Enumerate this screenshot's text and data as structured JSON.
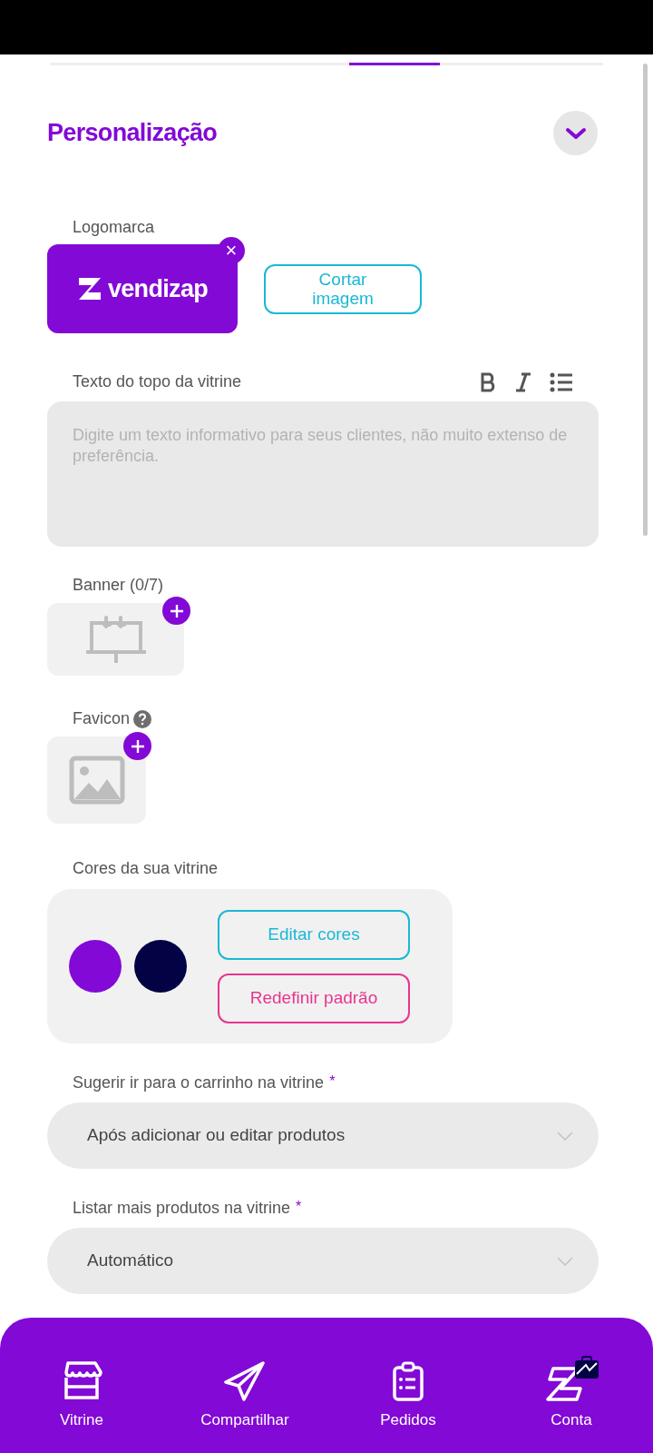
{
  "section": {
    "title": "Personalização",
    "expanded": true
  },
  "logo": {
    "label": "Logomarca",
    "wordmark": "vendizap",
    "crop_button": "Cortar imagem",
    "remove_icon": "×"
  },
  "header_text": {
    "label": "Texto do topo da vitrine",
    "placeholder": "Digite um texto informativo para seus clientes, não muito extenso de preferência."
  },
  "banner": {
    "label": "Banner (0/7)"
  },
  "favicon": {
    "label": "Favicon"
  },
  "colors": {
    "label": "Cores da sua vitrine",
    "swatches": [
      {
        "color": "#8309d6"
      },
      {
        "color": "#020244"
      }
    ],
    "buttons": [
      {
        "kind": "edit",
        "label": "Editar cores"
      },
      {
        "kind": "reset",
        "label": "Redefinir padrão"
      }
    ]
  },
  "selects": [
    {
      "label": "Sugerir ir para o carrinho na vitrine",
      "required_mark": "*",
      "value": "Após adicionar ou editar produtos"
    },
    {
      "label": "Listar mais produtos na vitrine",
      "required_mark": "*",
      "value": "Automático"
    }
  ],
  "nav": [
    {
      "kind": "store",
      "label": "Vitrine",
      "selected": false
    },
    {
      "kind": "share",
      "label": "Compartilhar",
      "selected": false
    },
    {
      "kind": "orders",
      "label": "Pedidos",
      "selected": false
    },
    {
      "kind": "account",
      "label": "Conta",
      "selected": false
    }
  ]
}
